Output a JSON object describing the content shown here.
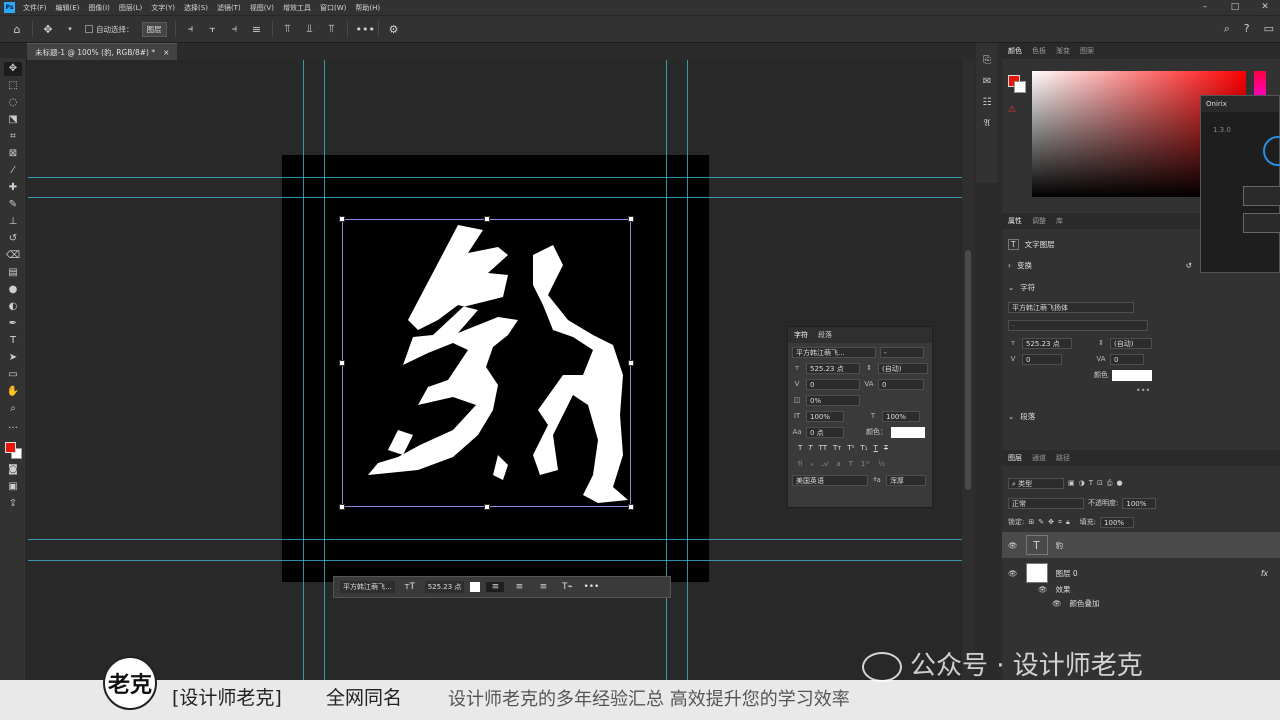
{
  "menu": [
    "文件(F)",
    "编辑(E)",
    "图像(I)",
    "图层(L)",
    "文字(Y)",
    "选择(S)",
    "滤镜(T)",
    "视图(V)",
    "增效工具",
    "窗口(W)",
    "帮助(H)"
  ],
  "options": {
    "auto_select_label": "自动选择：",
    "auto_select_value": "图层"
  },
  "document_tab": {
    "title": "未标题-1 @ 100% (豹, RGB/8#) *",
    "close": "×"
  },
  "canvas": {
    "glyph": "豹"
  },
  "context_bar": {
    "font": "平方韩江萌飞...",
    "size": "525.23 点"
  },
  "char_panel": {
    "tabs": [
      "字符",
      "段落"
    ],
    "font": "平方韩江萌飞...",
    "font_style": "-",
    "size": "525.23 点",
    "leading": "(自动)",
    "kerning": "0",
    "tracking": "0",
    "scale_pct": "0%",
    "vscale": "100%",
    "hscale": "100%",
    "baseline": "0 点",
    "color_label": "颜色：",
    "language": "美国英语",
    "aa": "浑厚"
  },
  "color_panel": {
    "tabs": [
      "颜色",
      "色板",
      "渐变",
      "图案"
    ],
    "fg": "#e8150d",
    "bg": "#ffffff"
  },
  "onirix": {
    "title": "Onirix",
    "version": "1.3.0"
  },
  "properties": {
    "tabs": [
      "属性",
      "调整",
      "库"
    ],
    "kind": "文字图层",
    "transform_label": "变换",
    "char_label": "字符",
    "font": "平方韩江萌飞扬体",
    "size": "525.23 点",
    "leading": "(自动)",
    "kerning": "0",
    "tracking": "0",
    "color_label": "颜色",
    "para_label": "段落"
  },
  "layers": {
    "tabs": [
      "图层",
      "通道",
      "路径"
    ],
    "filter": "类型",
    "blend": "正常",
    "opacity_label": "不透明度:",
    "opacity": "100%",
    "lock_label": "锁定:",
    "fill_label": "填充:",
    "fill": "100%",
    "items": [
      {
        "name": "豹",
        "kind": "T"
      },
      {
        "name": "图层 0",
        "kind": ""
      }
    ],
    "effects_label": "效果",
    "effect": "颜色叠加",
    "fx": "fx"
  },
  "banner": {
    "logo": "老克",
    "left": "[设计师老克]",
    "mid": "全网同名",
    "right": "设计师老克的多年经验汇总  高效提升您的学习效率"
  },
  "watermark": "公众号 · 设计师老克"
}
